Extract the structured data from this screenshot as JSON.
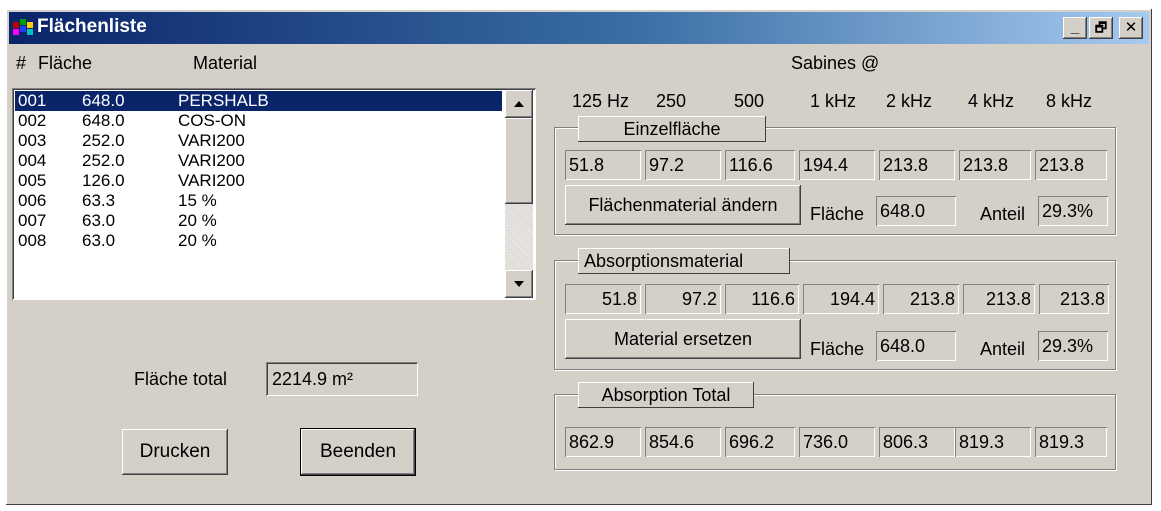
{
  "window": {
    "title": "Flächenliste",
    "controls": {
      "minimize": "_",
      "restore": "🗗",
      "close": "✕"
    }
  },
  "list": {
    "headers": {
      "num": "#",
      "area": "Fläche",
      "material": "Material"
    },
    "rows": [
      {
        "num": "001",
        "area": "648.0",
        "material": "PERSHALB",
        "selected": true
      },
      {
        "num": "002",
        "area": "648.0",
        "material": "COS-ON"
      },
      {
        "num": "003",
        "area": "252.0",
        "material": "VARI200"
      },
      {
        "num": "004",
        "area": "252.0",
        "material": "VARI200"
      },
      {
        "num": "005",
        "area": "126.0",
        "material": "VARI200"
      },
      {
        "num": "006",
        "area": "63.3",
        "material": "15 %"
      },
      {
        "num": "007",
        "area": "63.0",
        "material": "20 %"
      },
      {
        "num": "008",
        "area": "63.0",
        "material": "20 %"
      }
    ]
  },
  "total": {
    "label": "Fläche total",
    "value": "2214.9 m²"
  },
  "buttons": {
    "print": "Drucken",
    "exit": "Beenden"
  },
  "sabines": {
    "label": "Sabines @",
    "freqs": [
      "125 Hz",
      "250",
      "500",
      "1 kHz",
      "2 kHz",
      "4 kHz",
      "8 kHz"
    ]
  },
  "einzel": {
    "caption": "Einzelfläche",
    "values": [
      "51.8",
      "97.2",
      "116.6",
      "194.4",
      "213.8",
      "213.8",
      "213.8"
    ],
    "change_button": "Flächenmaterial ändern",
    "area_label": "Fläche",
    "area_value": "648.0",
    "share_label": "Anteil",
    "share_value": "29.3%"
  },
  "absorption": {
    "caption": "Absorptionsmaterial",
    "values": [
      "51.8",
      "97.2",
      "116.6",
      "194.4",
      "213.8",
      "213.8",
      "213.8"
    ],
    "replace_button": "Material ersetzen",
    "area_label": "Fläche",
    "area_value": "648.0",
    "share_label": "Anteil",
    "share_value": "29.3%"
  },
  "total_absorption": {
    "caption": "Absorption Total",
    "values": [
      "862.9",
      "854.6",
      "696.2",
      "736.0",
      "806.3",
      "819.3",
      "819.3"
    ]
  },
  "colors": {
    "title_start": "#0a246a",
    "title_end": "#a6caf0",
    "face": "#d4d0c8",
    "selection": "#0a246a"
  }
}
